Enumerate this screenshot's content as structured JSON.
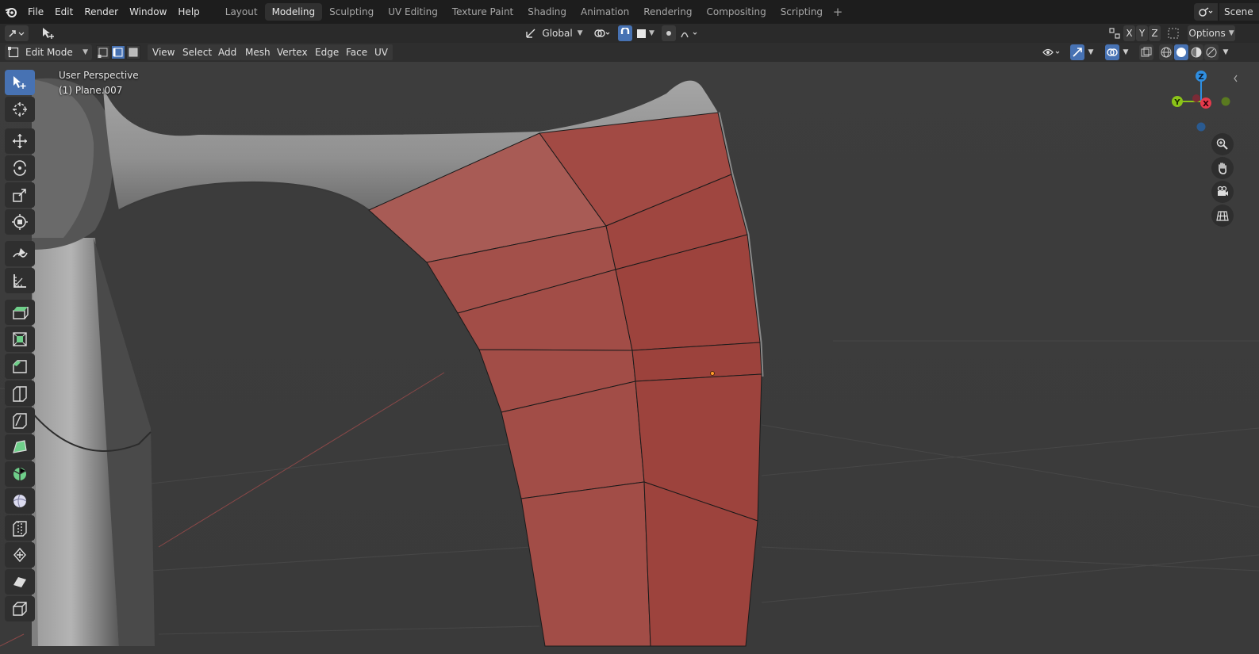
{
  "menubar": {
    "items": [
      "File",
      "Edit",
      "Render",
      "Window",
      "Help"
    ],
    "workspaces": [
      "Layout",
      "Modeling",
      "Sculpting",
      "UV Editing",
      "Texture Paint",
      "Shading",
      "Animation",
      "Rendering",
      "Compositing",
      "Scripting"
    ],
    "active_workspace": "Modeling",
    "scene_label": "Scene"
  },
  "tool_header": {
    "orientation": "Global",
    "axes": [
      "X",
      "Y",
      "Z"
    ],
    "options_label": "Options"
  },
  "viewport_header": {
    "mode": "Edit Mode",
    "menus": [
      "View",
      "Select",
      "Add",
      "Mesh",
      "Vertex",
      "Edge",
      "Face",
      "UV"
    ],
    "active_select_mode": "edge"
  },
  "viewport": {
    "perspective_label": "User Perspective",
    "object_label": "(1) Plane.007"
  },
  "gizmo": {
    "x_label": "X",
    "y_label": "Y",
    "z_label": "Z",
    "colors": {
      "x": "#e53a4c",
      "y": "#8bc418",
      "z": "#2f8ee0"
    }
  },
  "colors": {
    "accent": "#4772b3",
    "selected_face": "#a34a44",
    "mesh_gray": "#8f8f8f",
    "background": "#3c3c3c"
  },
  "toolbar": {
    "tools": [
      "select-box",
      "cursor",
      "move",
      "rotate",
      "scale",
      "transform",
      "annotate",
      "measure",
      "extrude-region",
      "inset-faces",
      "bevel",
      "loop-cut",
      "knife",
      "poly-build",
      "spin",
      "smooth",
      "edge-slide",
      "shrink-fatten",
      "shear",
      "rip-region"
    ]
  }
}
